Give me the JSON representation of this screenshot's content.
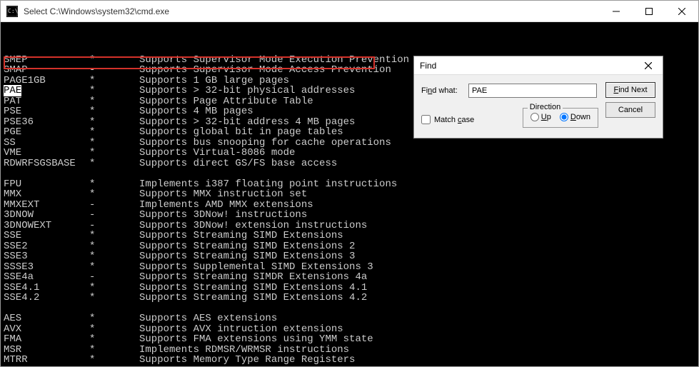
{
  "window": {
    "title": "Select C:\\Windows\\system32\\cmd.exe"
  },
  "lines": [
    {
      "name": "SMEP",
      "flag": "*",
      "desc": "Supports Supervisor Mode Execution Prevention"
    },
    {
      "name": "SMAP",
      "flag": "-",
      "desc": "Supports Supervisor Mode Access Prevention"
    },
    {
      "name": "PAGE1GB",
      "flag": "*",
      "desc": "Supports 1 GB large pages"
    },
    {
      "name": "PAE",
      "flag": "*",
      "desc": "Supports > 32-bit physical addresses"
    },
    {
      "name": "PAT",
      "flag": "*",
      "desc": "Supports Page Attribute Table"
    },
    {
      "name": "PSE",
      "flag": "*",
      "desc": "Supports 4 MB pages"
    },
    {
      "name": "PSE36",
      "flag": "*",
      "desc": "Supports > 32-bit address 4 MB pages"
    },
    {
      "name": "PGE",
      "flag": "*",
      "desc": "Supports global bit in page tables"
    },
    {
      "name": "SS",
      "flag": "*",
      "desc": "Supports bus snooping for cache operations"
    },
    {
      "name": "VME",
      "flag": "*",
      "desc": "Supports Virtual-8086 mode"
    },
    {
      "name": "RDWRFSGSBASE",
      "flag": "*",
      "desc": "Supports direct GS/FS base access"
    },
    {
      "name": "",
      "flag": "",
      "desc": ""
    },
    {
      "name": "FPU",
      "flag": "*",
      "desc": "Implements i387 floating point instructions"
    },
    {
      "name": "MMX",
      "flag": "*",
      "desc": "Supports MMX instruction set"
    },
    {
      "name": "MMXEXT",
      "flag": "-",
      "desc": "Implements AMD MMX extensions"
    },
    {
      "name": "3DNOW",
      "flag": "-",
      "desc": "Supports 3DNow! instructions"
    },
    {
      "name": "3DNOWEXT",
      "flag": "-",
      "desc": "Supports 3DNow! extension instructions"
    },
    {
      "name": "SSE",
      "flag": "*",
      "desc": "Supports Streaming SIMD Extensions"
    },
    {
      "name": "SSE2",
      "flag": "*",
      "desc": "Supports Streaming SIMD Extensions 2"
    },
    {
      "name": "SSE3",
      "flag": "*",
      "desc": "Supports Streaming SIMD Extensions 3"
    },
    {
      "name": "SSSE3",
      "flag": "*",
      "desc": "Supports Supplemental SIMD Extensions 3"
    },
    {
      "name": "SSE4a",
      "flag": "-",
      "desc": "Supports Streaming SIMDR Extensions 4a"
    },
    {
      "name": "SSE4.1",
      "flag": "*",
      "desc": "Supports Streaming SIMD Extensions 4.1"
    },
    {
      "name": "SSE4.2",
      "flag": "*",
      "desc": "Supports Streaming SIMD Extensions 4.2"
    },
    {
      "name": "",
      "flag": "",
      "desc": ""
    },
    {
      "name": "AES",
      "flag": "*",
      "desc": "Supports AES extensions"
    },
    {
      "name": "AVX",
      "flag": "*",
      "desc": "Supports AVX intruction extensions"
    },
    {
      "name": "FMA",
      "flag": "*",
      "desc": "Supports FMA extensions using YMM state"
    },
    {
      "name": "MSR",
      "flag": "*",
      "desc": "Implements RDMSR/WRMSR instructions"
    },
    {
      "name": "MTRR",
      "flag": "*",
      "desc": "Supports Memory Type Range Registers"
    }
  ],
  "find": {
    "title": "Find",
    "label": "Find what:",
    "value": "PAE",
    "findNext": "Find Next",
    "cancel": "Cancel",
    "matchCase": "Match case",
    "direction": "Direction",
    "up": "Up",
    "down": "Down"
  }
}
